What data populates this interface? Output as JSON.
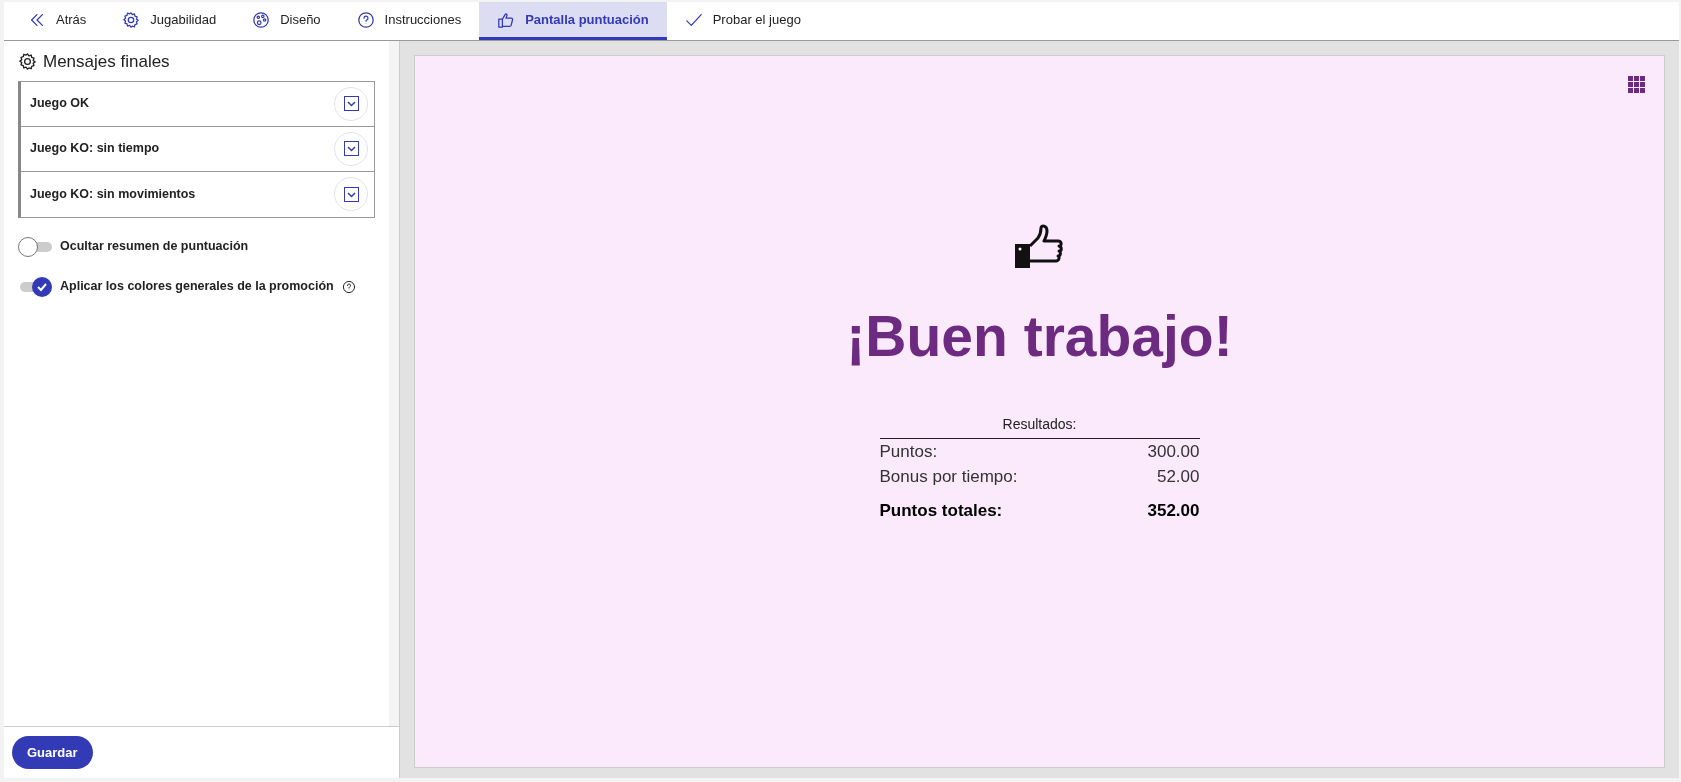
{
  "tabs": [
    {
      "label": "Atrás",
      "kind": "back",
      "selected": false
    },
    {
      "label": "Jugabilidad",
      "kind": "gear",
      "selected": false
    },
    {
      "label": "Diseño",
      "kind": "palette",
      "selected": false
    },
    {
      "label": "Instrucciones",
      "kind": "help",
      "selected": false
    },
    {
      "label": "Pantalla puntuación",
      "kind": "thumb",
      "selected": true
    },
    {
      "label": "Probar el juego",
      "kind": "check",
      "selected": false
    }
  ],
  "sidebar": {
    "title": "Mensajes finales",
    "messages": [
      {
        "label": "Juego OK",
        "expanded": false
      },
      {
        "label": "Juego KO: sin tiempo",
        "expanded": false
      },
      {
        "label": "Juego KO: sin movimientos",
        "expanded": false
      }
    ],
    "toggles": [
      {
        "label": "Ocultar resumen de puntuación",
        "on": false,
        "help": false
      },
      {
        "label": "Aplicar los colores generales de la promoción",
        "on": true,
        "help": true
      }
    ],
    "save_button": "Guardar"
  },
  "preview": {
    "heading": "¡Buen trabajo!",
    "results_title": "Resultados:",
    "rows": [
      {
        "label": "Puntos:",
        "value": "300.00",
        "kind": "normal"
      },
      {
        "label": "Bonus por tiempo:",
        "value": "52.00",
        "kind": "normal"
      },
      {
        "label": "Puntos totales:",
        "value": "352.00",
        "kind": "total"
      }
    ]
  }
}
